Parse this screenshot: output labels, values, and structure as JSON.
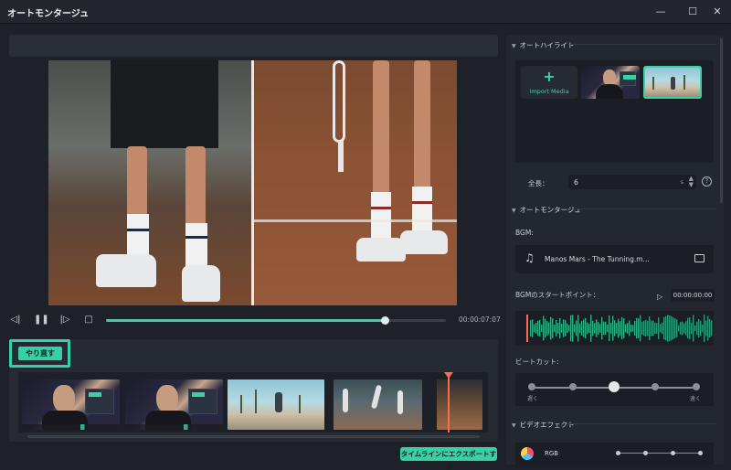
{
  "window": {
    "title": "オートモンタージュ",
    "minimize_glyph": "—",
    "maximize_glyph": "☐",
    "close_glyph": "✕"
  },
  "player": {
    "prev_frame_icon": "step-back-icon",
    "pause_icon": "pause-icon",
    "next_frame_icon": "step-forward-icon",
    "stop_icon": "stop-icon",
    "progress": 0.82,
    "time": "00:00:07:07"
  },
  "strip": {
    "redo_label": "やり直す",
    "clips": [
      {
        "kind": "person"
      },
      {
        "kind": "person"
      },
      {
        "kind": "beach"
      },
      {
        "kind": "tennis"
      },
      {
        "kind": "last"
      }
    ]
  },
  "export_label": "タイムラインにエクスポートする",
  "right": {
    "highlight_header": "オートハイライト",
    "import_label": "Import Media",
    "import_plus": "+",
    "length_label": "全長：",
    "length_value": "6",
    "length_unit": "s",
    "help_glyph": "?",
    "montage_header": "オートモンタージュ",
    "bgm_label": "BGM:",
    "music_name": "Manos Mars - The Tunning.m...",
    "music_glyph": "♫",
    "bgm_start_label": "BGMのスタートポイント：",
    "start_play_glyph": "▷",
    "start_time": "00:00:00:00",
    "beat_cut_label": "ビートカット:",
    "slow_left": "遅く",
    "fast_right": "速く",
    "beat_level": 0.5,
    "video_effect_header": "ビデオエフェクト",
    "effect_name": "RGB"
  },
  "colors": {
    "accent": "#37d1a5",
    "playhead": "#ff6a4d",
    "background": "#1e2228"
  }
}
